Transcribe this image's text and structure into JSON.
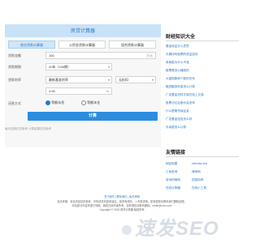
{
  "calc": {
    "title": "房贷计算器",
    "tabs": [
      "商业贷款计算器",
      "公积金贷款计算器",
      "组合贷款计算器"
    ],
    "fields": {
      "loan_amount_label": "贷款金额",
      "loan_amount_value": "100",
      "loan_amount_unit": "万元",
      "term_label": "贷款期限",
      "term_value": "20年（240期）",
      "rate_label": "贷款利率",
      "rate_select": "最新基准利率",
      "rate_multiple": "无折扣",
      "rate_value": "4.90",
      "rate_unit": "%",
      "method_label": "还款方式",
      "method_opt1": "等额本息",
      "method_opt2": "等额本金"
    },
    "button": "计算",
    "note": "每月还款仅供参考 计算结果仅供参考"
  },
  "sidebar": {
    "articles_title": "财经知识大全",
    "articles": [
      "基金收益什么意思",
      "长期持有股票的收益如何",
      "券商股为什么不涨",
      "股票是怎么赚钱的",
      "大盘指数和个股的关系",
      "融资融券利息怎么计算",
      "广发基金怎样才能在线上交易",
      "股票分红后股价会怎样",
      "什么是期货保证金",
      "广发基金定投怎么样",
      "手续费怎么计算"
    ],
    "links_title": "友情链接",
    "links": [
      "网站地图",
      "sitemap.xml",
      "工商查询",
      "律师网",
      "劳动仲裁网",
      "招投标网",
      "在线计算器",
      "在线小工具"
    ]
  },
  "footer": {
    "line1": "关于我们 | 联系我们 | 免责声明",
    "line2": "免责声明：本站内容仅供参考，不构成任何投资建议。投资有风险，入市需谨慎。如有侵权请联系我们删除处理。",
    "line3": "本站部分内容来源于网络，版权归原作者所有，如有侵权请联系删除。email@xxxx.com",
    "line4": "Copyright © 2023 房贷计算器 版权所有"
  },
  "logo": {
    "text": "速发SEO"
  }
}
